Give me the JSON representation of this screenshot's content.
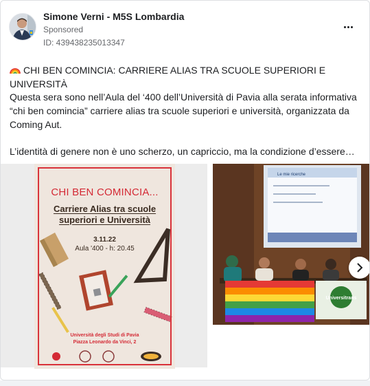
{
  "post": {
    "page_name": "Simone Verni - M5S Lombardia",
    "sponsored_label": "Sponsored",
    "ad_id": "ID: 439438235013347",
    "title_emoji": "rainbow-icon",
    "title": "CHI BEN COMINCIA: CARRIERE ALIAS TRA SCUOLE SUPERIORI E UNIVERSITÀ",
    "body": "Questa sera sono nell’Aula del ‘400 dell’Università di Pavia alla serata informativa “chi ben comincia” carriere alias tra scuole superiori e università, organizzata da Coming Aut.",
    "teaser": "L’identità di genere non è uno scherzo, un capriccio, ma la condizione d’essere…"
  },
  "media": {
    "poster": {
      "title": "CHI BEN COMINCIA...",
      "subtitle_line1": "Carriere Alias tra scuole",
      "subtitle_line2": "superiori e Università",
      "date": "3.11.22",
      "venue": "Aula '400 - h: 20.45",
      "university": "Università degli Studi di Pavia",
      "address": "Piazza Leonardo da Vinci, 2"
    },
    "photo2": {
      "slide_title": "Le mie ricerche",
      "banner_text": "Universitrans"
    }
  },
  "icons": {
    "more": "more-horizontal-icon",
    "next": "chevron-right-icon"
  },
  "colors": {
    "text": "#1c1e21",
    "secondary": "#65676b",
    "poster_red": "#d42a35",
    "divider": "#dddfe2"
  }
}
